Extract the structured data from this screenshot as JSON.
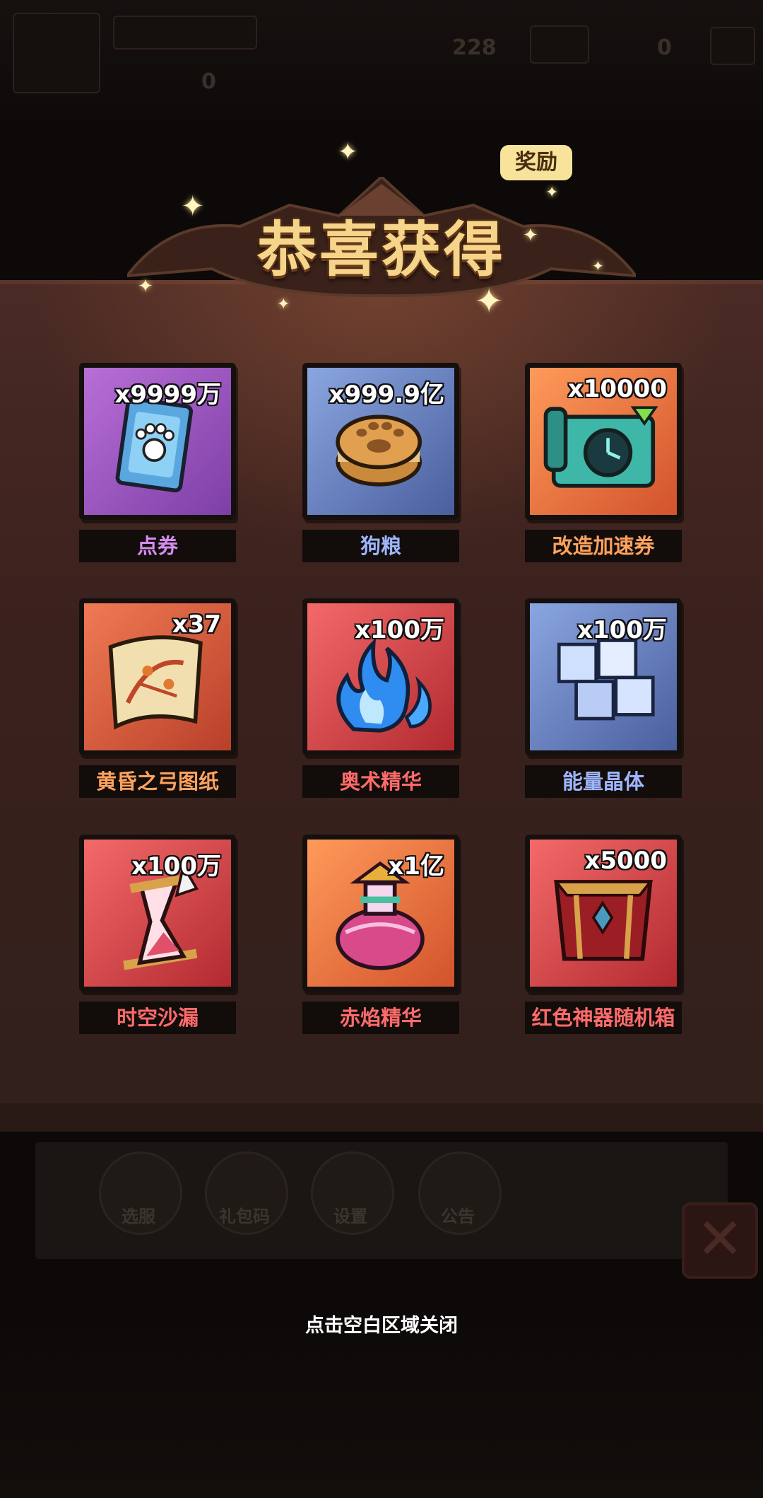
{
  "background": {
    "top_stats": [
      "228",
      "0",
      "0"
    ],
    "bottom_buttons": [
      "选服",
      "礼包码",
      "设置",
      "公告"
    ]
  },
  "reward_popup": {
    "title": "恭喜获得",
    "badge": "奖励",
    "items": [
      {
        "name": "点券",
        "quantity": "x9999万",
        "rarity": "purple",
        "icon": "paw-ticket-icon"
      },
      {
        "name": "狗粮",
        "quantity": "x999.9亿",
        "rarity": "blue",
        "icon": "dog-biscuit-icon"
      },
      {
        "name": "改造加速券",
        "quantity": "x10000",
        "rarity": "orange",
        "icon": "clock-scroll-icon"
      },
      {
        "name": "黄昏之弓图纸",
        "quantity": "x37",
        "rarity": "orange",
        "icon": "blueprint-scroll-icon"
      },
      {
        "name": "奥术精华",
        "quantity": "x100万",
        "rarity": "red",
        "icon": "blue-flame-icon"
      },
      {
        "name": "能量晶体",
        "quantity": "x100万",
        "rarity": "blue",
        "icon": "energy-cube-icon"
      },
      {
        "name": "时空沙漏",
        "quantity": "x100万",
        "rarity": "red",
        "icon": "hourglass-icon"
      },
      {
        "name": "赤焰精华",
        "quantity": "x1亿",
        "rarity": "red",
        "icon": "potion-flask-icon"
      },
      {
        "name": "红色神器随机箱",
        "quantity": "x5000",
        "rarity": "red",
        "icon": "artifact-chest-icon"
      }
    ],
    "close_hint": "点击空白区域关闭"
  },
  "colors": {
    "purple": "#d78cf0",
    "blue": "#9fb6ff",
    "orange": "#ffa25e",
    "red": "#ff6b6b",
    "title_gold": "#f5d58a"
  }
}
